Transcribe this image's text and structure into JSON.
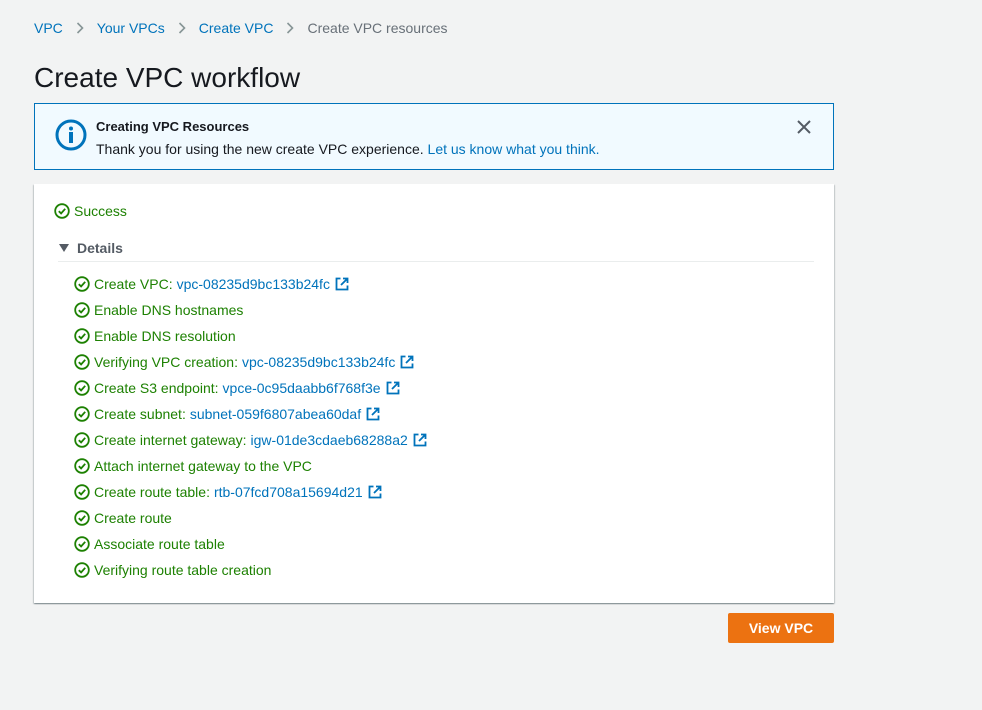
{
  "breadcrumb": {
    "items": [
      "VPC",
      "Your VPCs",
      "Create VPC"
    ],
    "current": "Create VPC resources"
  },
  "page_title": "Create VPC workflow",
  "flash": {
    "icon": "info-icon",
    "title": "Creating VPC Resources",
    "message": "Thank you for using the new create VPC experience.",
    "link_text": "Let us know what you think."
  },
  "status": {
    "icon": "check-circle-icon",
    "label": "Success"
  },
  "details": {
    "label": "Details",
    "expanded": true,
    "steps": [
      {
        "label": "Create VPC:",
        "resource": "vpc-08235d9bc133b24fc"
      },
      {
        "label": "Enable DNS hostnames"
      },
      {
        "label": "Enable DNS resolution"
      },
      {
        "label": "Verifying VPC creation:",
        "resource": "vpc-08235d9bc133b24fc"
      },
      {
        "label": "Create S3 endpoint:",
        "resource": "vpce-0c95daabb6f768f3e"
      },
      {
        "label": "Create subnet:",
        "resource": "subnet-059f6807abea60daf"
      },
      {
        "label": "Create internet gateway:",
        "resource": "igw-01de3cdaeb68288a2"
      },
      {
        "label": "Attach internet gateway to the VPC"
      },
      {
        "label": "Create route table:",
        "resource": "rtb-07fcd708a15694d21"
      },
      {
        "label": "Create route"
      },
      {
        "label": "Associate route table"
      },
      {
        "label": "Verifying route table creation"
      }
    ]
  },
  "actions": {
    "view_vpc": "View VPC"
  },
  "colors": {
    "link": "#0073bb",
    "success": "#1d8102",
    "primary_button": "#ec7211",
    "info_border": "#0073bb",
    "info_background": "#f1faff",
    "page_background": "#f2f3f3"
  }
}
